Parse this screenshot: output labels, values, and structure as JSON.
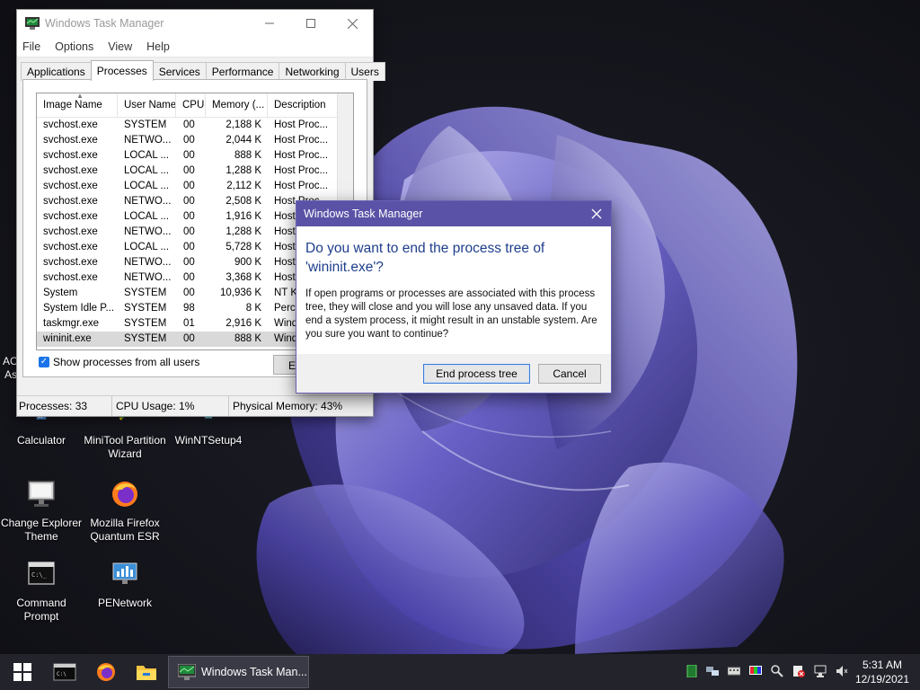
{
  "desktop": {
    "icons": [
      {
        "label": "Calculator"
      },
      {
        "label": "MiniTool Partition Wizard"
      },
      {
        "label": "WinNTSetup4"
      },
      {
        "label": "Change Explorer Theme"
      },
      {
        "label": "Mozilla Firefox Quantum ESR"
      },
      {
        "label": "Command Prompt"
      },
      {
        "label": "PENetwork"
      }
    ],
    "partial_labels": [
      "AO",
      "As"
    ]
  },
  "task_manager": {
    "title": "Windows Task Manager",
    "menu": [
      "File",
      "Options",
      "View",
      "Help"
    ],
    "tabs": [
      "Applications",
      "Processes",
      "Services",
      "Performance",
      "Networking",
      "Users"
    ],
    "active_tab": "Processes",
    "columns": [
      "Image Name",
      "User Name",
      "CPU",
      "Memory (...",
      "Description"
    ],
    "rows": [
      {
        "name": "svchost.exe",
        "user": "SYSTEM",
        "cpu": "00",
        "mem": "2,188 K",
        "desc": "Host Proc..."
      },
      {
        "name": "svchost.exe",
        "user": "NETWO...",
        "cpu": "00",
        "mem": "2,044 K",
        "desc": "Host Proc..."
      },
      {
        "name": "svchost.exe",
        "user": "LOCAL ...",
        "cpu": "00",
        "mem": "888 K",
        "desc": "Host Proc..."
      },
      {
        "name": "svchost.exe",
        "user": "LOCAL ...",
        "cpu": "00",
        "mem": "1,288 K",
        "desc": "Host Proc..."
      },
      {
        "name": "svchost.exe",
        "user": "LOCAL ...",
        "cpu": "00",
        "mem": "2,112 K",
        "desc": "Host Proc..."
      },
      {
        "name": "svchost.exe",
        "user": "NETWO...",
        "cpu": "00",
        "mem": "2,508 K",
        "desc": "Host Proc..."
      },
      {
        "name": "svchost.exe",
        "user": "LOCAL ...",
        "cpu": "00",
        "mem": "1,916 K",
        "desc": "Host"
      },
      {
        "name": "svchost.exe",
        "user": "NETWO...",
        "cpu": "00",
        "mem": "1,288 K",
        "desc": "Host"
      },
      {
        "name": "svchost.exe",
        "user": "LOCAL ...",
        "cpu": "00",
        "mem": "5,728 K",
        "desc": "Host"
      },
      {
        "name": "svchost.exe",
        "user": "NETWO...",
        "cpu": "00",
        "mem": "900 K",
        "desc": "Host"
      },
      {
        "name": "svchost.exe",
        "user": "NETWO...",
        "cpu": "00",
        "mem": "3,368 K",
        "desc": "Host"
      },
      {
        "name": "System",
        "user": "SYSTEM",
        "cpu": "00",
        "mem": "10,936 K",
        "desc": "NT Ke"
      },
      {
        "name": "System Idle P...",
        "user": "SYSTEM",
        "cpu": "98",
        "mem": "8 K",
        "desc": "Perce"
      },
      {
        "name": "taskmgr.exe",
        "user": "SYSTEM",
        "cpu": "01",
        "mem": "2,916 K",
        "desc": "Wind"
      },
      {
        "name": "wininit.exe",
        "user": "SYSTEM",
        "cpu": "00",
        "mem": "888 K",
        "desc": "Wind"
      }
    ],
    "selected_row": 14,
    "show_all_users_label": "Show processes from all users",
    "show_all_users_checked": true,
    "end_process_label": "End",
    "status": {
      "processes": "Processes: 33",
      "cpu": "CPU Usage: 1%",
      "memory": "Physical Memory: 43%"
    }
  },
  "dialog": {
    "title": "Windows Task Manager",
    "question": "Do you want to end the process tree of 'wininit.exe'?",
    "message": "If open programs or processes are associated with this process tree, they will close and you will lose any unsaved data. If you end a system process, it might result in an unstable system. Are you sure you want to continue?",
    "confirm_label": "End process tree",
    "cancel_label": "Cancel"
  },
  "taskbar": {
    "active_task_label": "Windows Task Man...",
    "clock_time": "5:31 AM",
    "clock_date": "12/19/2021"
  },
  "colors": {
    "dialog_title_bar": "#5a52a6",
    "question_text": "#1e3e8c",
    "checkbox_accent": "#1a73e8",
    "taskbar": "#23232c"
  }
}
